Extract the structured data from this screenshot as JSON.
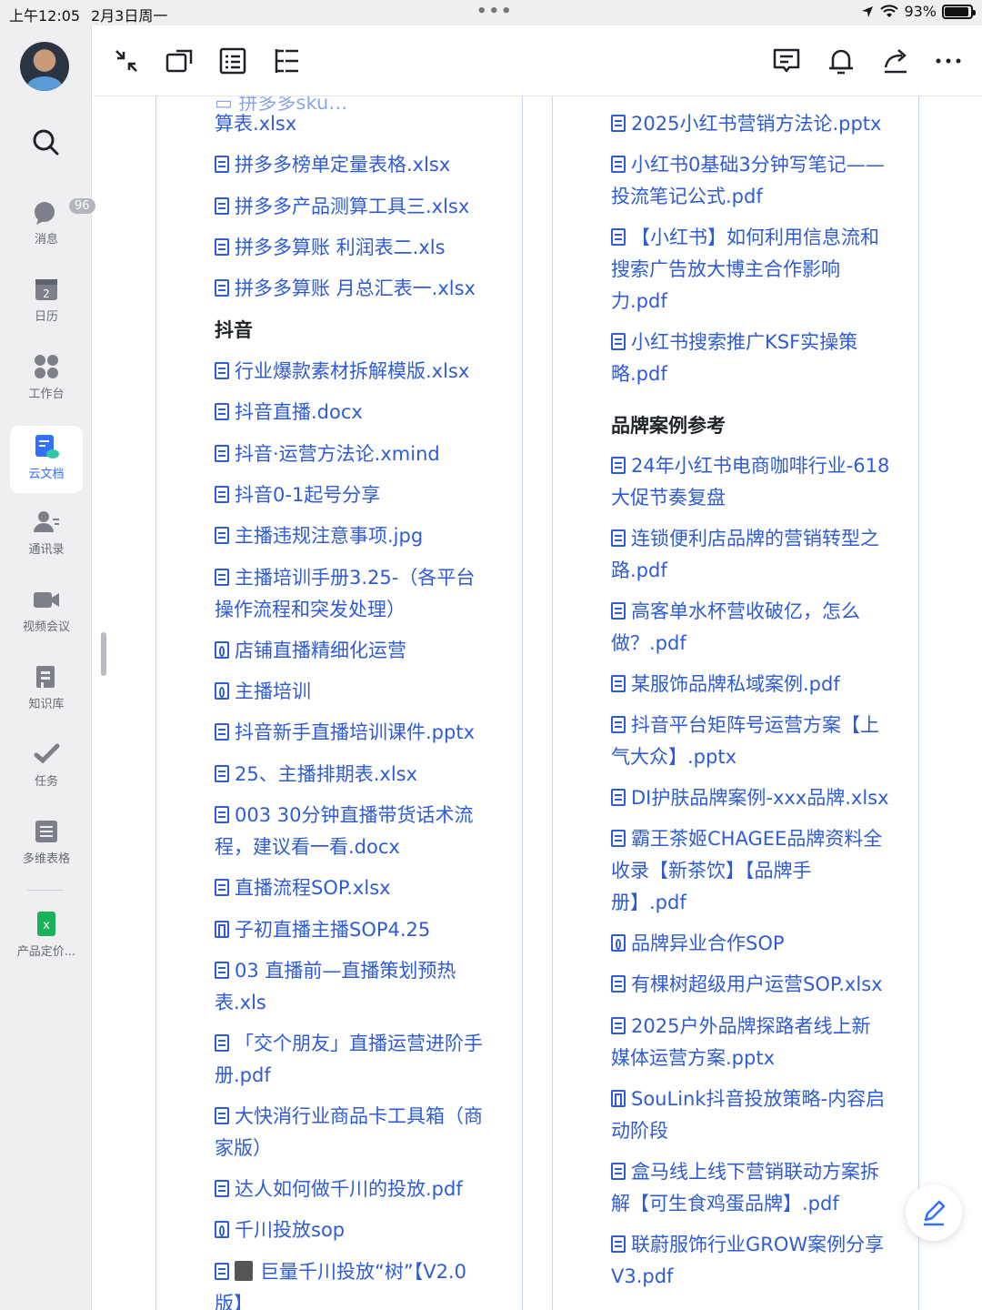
{
  "status_bar": {
    "time": "上午12:05",
    "date": "2月3日周一",
    "battery": "93%"
  },
  "sidebar": {
    "badge_count": "96",
    "items": [
      {
        "label": "消息"
      },
      {
        "label": "日历",
        "day": "2"
      },
      {
        "label": "工作台"
      },
      {
        "label": "云文档"
      },
      {
        "label": "通讯录"
      },
      {
        "label": "视频会议"
      },
      {
        "label": "知识库"
      },
      {
        "label": "任务"
      },
      {
        "label": "多维表格"
      },
      {
        "label": "产品定价..."
      }
    ],
    "xls_letter": "x"
  },
  "left_column": {
    "top_partial": "算表.xlsx",
    "items_a": [
      "拼多多榜单定量表格.xlsx",
      "拼多多产品测算工具三.xlsx",
      "拼多多算账 利润表二.xls",
      "拼多多算账 月总汇表一.xlsx"
    ],
    "heading": "抖音",
    "items_b": [
      "行业爆款素材拆解模版.xlsx",
      "抖音直播.docx",
      "抖音·运营方法论.xmind",
      "抖音0-1起号分享",
      "主播违规注意事项.jpg"
    ],
    "item_training_1": "主播培训手册3.25-（各平台",
    "item_training_2": "操作流程和突发处理）",
    "items_c": [
      "店铺直播精细化运营",
      "主播培训",
      "抖音新手直播培训课件.pptx",
      "25、主播排期表.xlsx"
    ],
    "item_003_1": "003  30分钟直播带货话术流",
    "item_003_2": "程，建议看一看.docx",
    "items_d": [
      "直播流程SOP.xlsx",
      "子初直播主播SOP4.25"
    ],
    "item_03_1": "03 直播前—直播策划预热",
    "item_03_2": "表.xls",
    "item_friend_1": "「交个朋友」直播运营进阶手",
    "item_friend_2": "册.pdf",
    "item_fmcg_1": "大快消行业商品卡工具箱（商",
    "item_fmcg_2": "家版）",
    "items_e": [
      "达人如何做千川的投放.pdf",
      "千川投放sop"
    ],
    "item_tree_1": "巨量千川投放“树”【V2.0",
    "item_tree_2": "版】"
  },
  "right_column": {
    "r1": "2025小红书营销方法论.pptx",
    "r2_1": "小红书0基础3分钟写笔记——",
    "r2_2": "投流笔记公式.pdf",
    "r3_1": "【小红书】如何利用信息流和",
    "r3_2": "搜索广告放大博主合作影响",
    "r3_3": "力.pdf",
    "r4_1": "小红书搜索推广KSF实操策",
    "r4_2": "略.pdf",
    "heading": "品牌案例参考",
    "r5_1": "24年小红书电商咖啡行业-618",
    "r5_2": "大促节奏复盘",
    "r6_1": "连锁便利店品牌的营销转型之",
    "r6_2": "路.pdf",
    "r7_1": "高客单水杯营收破亿，怎么",
    "r7_2": "做？.pdf",
    "r8": "某服饰品牌私域案例.pdf",
    "r9_1": "抖音平台矩阵号运营方案【上",
    "r9_2": "气大众】.pptx",
    "r10": "DI护肤品牌案例-xxx品牌.xlsx",
    "r11_1": "霸王茶姬CHAGEE品牌资料全",
    "r11_2": "收录【新茶饮】【品牌手",
    "r11_3": "册】.pdf",
    "r12": "品牌异业合作SOP",
    "r13": "有棵树超级用户运营SOP.xlsx",
    "r14_1": "2025户外品牌探路者线上新",
    "r14_2": "媒体运营方案.pptx",
    "r15_1": "SouLink抖音投放策略-内容启",
    "r15_2": "动阶段",
    "r16_1": "盒马线上线下营销联动方案拆",
    "r16_2": "解【可生食鸡蛋品牌】.pdf",
    "r17_1": "联蔚服饰行业GROW案例分享",
    "r17_2": "V3.pdf"
  },
  "colors": {
    "link": "#2e5bd8",
    "accent": "#3370ff",
    "sidebar_bg": "#efeff1"
  }
}
